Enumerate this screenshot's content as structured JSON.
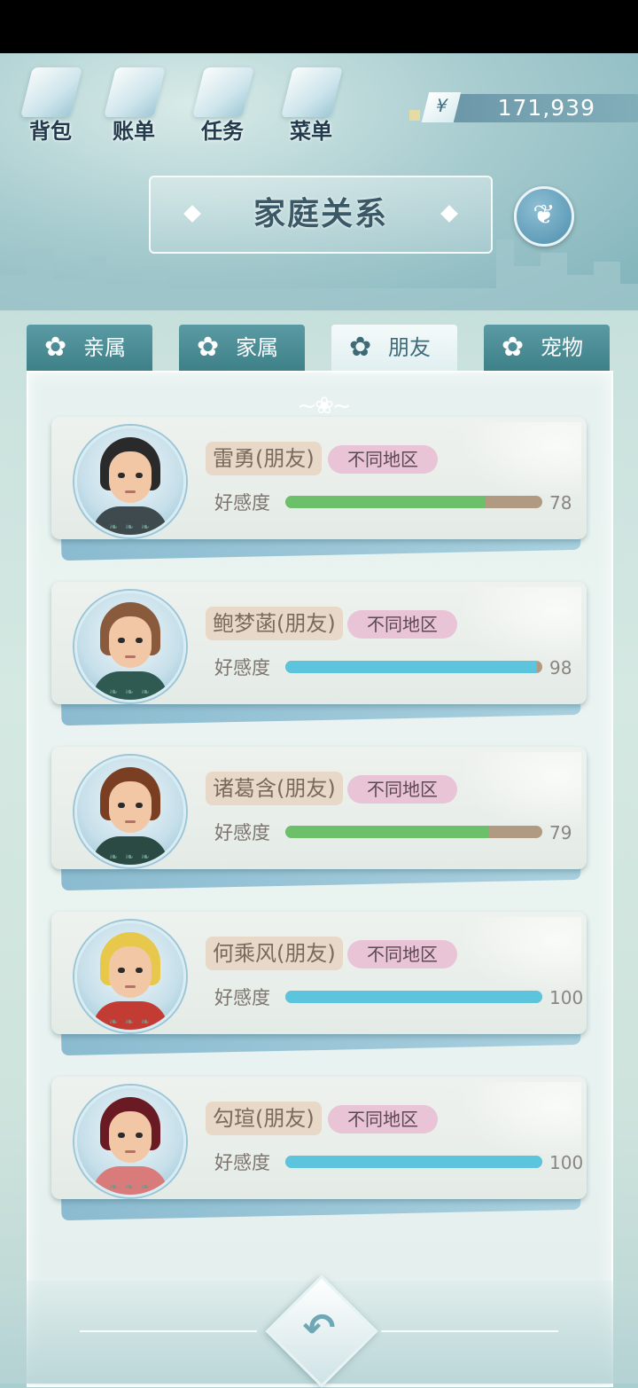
{
  "top_menu": [
    {
      "label": "背包",
      "icon": "bag-icon"
    },
    {
      "label": "账单",
      "icon": "bill-icon"
    },
    {
      "label": "任务",
      "icon": "task-icon"
    },
    {
      "label": "菜单",
      "icon": "menu-icon"
    }
  ],
  "currency": {
    "symbol": "¥",
    "amount": "171,939"
  },
  "title": "家庭关系",
  "tabs": [
    {
      "label": "亲属",
      "active": false
    },
    {
      "label": "家属",
      "active": false
    },
    {
      "label": "朋友",
      "active": true
    },
    {
      "label": "宠物",
      "active": false
    }
  ],
  "affinity_label": "好感度",
  "people": [
    {
      "name": "雷勇(朋友)",
      "region": "不同地区",
      "affinity": 78,
      "bar_color": "green",
      "hair": "#2a2a2a",
      "shirt": "#3e4a4e"
    },
    {
      "name": "鲍梦菡(朋友)",
      "region": "不同地区",
      "affinity": 98,
      "bar_color": "blue",
      "hair": "#8a5a3c",
      "shirt": "#2f5a52"
    },
    {
      "name": "诸葛含(朋友)",
      "region": "不同地区",
      "affinity": 79,
      "bar_color": "green",
      "hair": "#7a3f22",
      "shirt": "#2c4a44"
    },
    {
      "name": "何乘风(朋友)",
      "region": "不同地区",
      "affinity": 100,
      "bar_color": "blue",
      "hair": "#e8c84a",
      "shirt": "#c23c34"
    },
    {
      "name": "勾瑄(朋友)",
      "region": "不同地区",
      "affinity": 100,
      "bar_color": "blue",
      "hair": "#6a1a22",
      "shirt": "#d97b7b"
    }
  ],
  "back_icon": "back-arrow-icon"
}
